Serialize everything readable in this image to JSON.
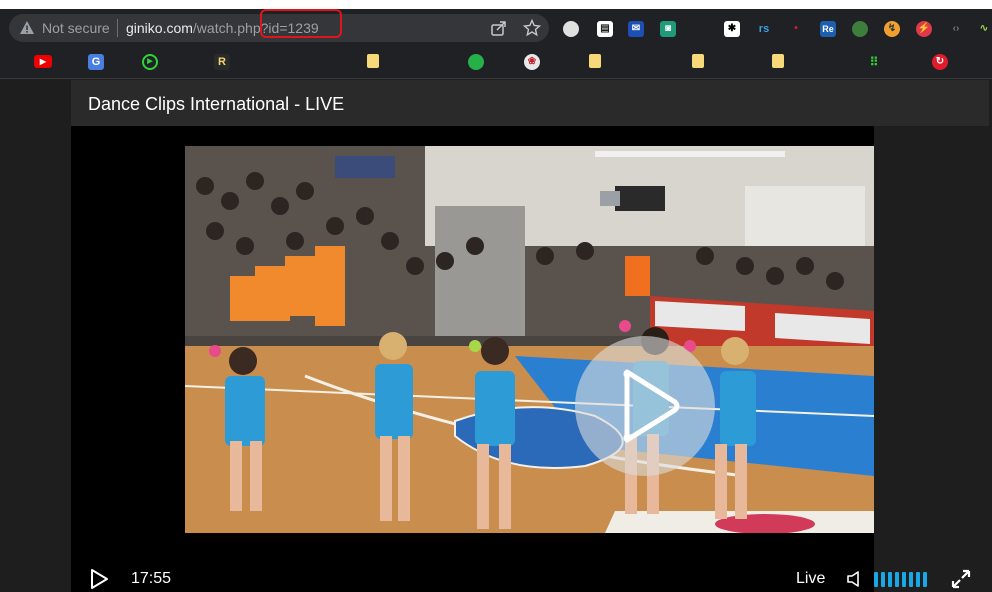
{
  "browser": {
    "security_label": "Not secure",
    "url_host": "giniko.com",
    "url_path": "/watch.php?id=1239",
    "extensions": [
      "globe-icon",
      "shelf-icon",
      "mail-icon",
      "android-icon",
      "gear-box-icon",
      "rs-icon",
      "red-dot-icon",
      "re-icon",
      "earth-icon",
      "chrome-dev-icon",
      "red-circle-icon",
      "code-icon",
      "graph-icon"
    ],
    "bookmarks": [
      "youtube-icon",
      "translate-icon",
      "play-circle-icon",
      "r-icon",
      "folder-icon",
      "earth-icon",
      "rose-icon",
      "folder-icon",
      "folder-icon",
      "folder-icon",
      "grid-icon",
      "refresh-red-icon"
    ]
  },
  "player": {
    "title": "Dance Clips International - LIVE",
    "time": "17:55",
    "live_label": "Live",
    "volume_level": 1.0
  },
  "colors": {
    "highlight": "#e0151b",
    "volume": "#19a7e6",
    "court_blue": "#2b7fd1",
    "floor": "#c98e4e"
  }
}
